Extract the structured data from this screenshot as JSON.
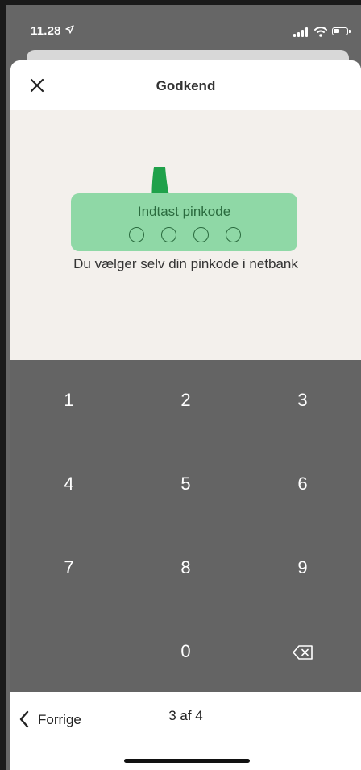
{
  "status_bar": {
    "time": "11.28",
    "location_icon": "location-arrow-icon",
    "signal_icon": "signal-icon",
    "wifi_icon": "wifi-icon",
    "battery_icon": "battery-icon",
    "battery_level": 0.45
  },
  "header": {
    "title": "Godkend",
    "close_icon": "close-icon"
  },
  "pin": {
    "label": "Indtast pinkode",
    "digits_total": 4,
    "digits_entered": 0,
    "box_color": "#8fd8a6"
  },
  "hint": "Du vælger selv din pinkode i netbank",
  "arrow": {
    "icon": "arrow-down-icon",
    "color": "#1fa14a"
  },
  "keypad": {
    "keys": [
      "1",
      "2",
      "3",
      "4",
      "5",
      "6",
      "7",
      "8",
      "9",
      "",
      "0"
    ],
    "backspace_icon": "backspace-icon",
    "background": "#646464"
  },
  "footer": {
    "previous_label": "Forrige",
    "previous_icon": "chevron-left-icon",
    "step_text": "3 af 4"
  }
}
